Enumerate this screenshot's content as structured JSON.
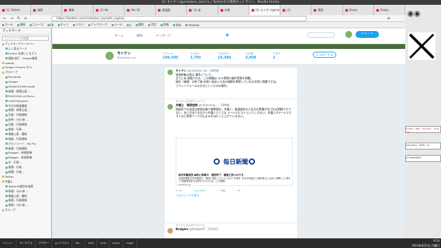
{
  "window": {
    "title": "(1) モトケン(@motoken_tw)さん | Twitterから政府ホットライン - Mozilla Firefox"
  },
  "tabs": [
    {
      "label": "(1) Twitter"
    },
    {
      "label": "検察"
    },
    {
      "label": "携帯"
    },
    {
      "label": "(1) Ab"
    },
    {
      "label": "Ato 10"
    },
    {
      "label": "高島屋"
    },
    {
      "label": "(1) 赤"
    },
    {
      "label": "半角"
    },
    {
      "label": "(1) モトケン(@motoken_tw)さん",
      "active": true
    },
    {
      "label": "(1)"
    },
    {
      "label": "菅原"
    },
    {
      "label": "Shoko"
    },
    {
      "label": "Shoko"
    }
  ],
  "nav": {
    "url": "https://twitter.com/motoken_tw/with_replies",
    "back": "←",
    "forward": "→",
    "reload": "↻",
    "home": "⌂"
  },
  "bookmarks_toolbar": [
    "ホーム",
    "通知",
    "ニュース",
    "FB",
    "ホット",
    "リスト",
    "ブックマーク",
    "メール",
    "G",
    "翻訳",
    "予定",
    "投稿",
    "Wiki",
    "Amazon"
  ],
  "sidebar": {
    "title": "ブックマーク",
    "search_placeholder": "ブックマークを検索",
    "items": [
      {
        "label": "ブックマークツールバー",
        "folder": true
      },
      {
        "label": "よく見るページ",
        "folder": false
      },
      {
        "label": "Firefox を使いこなそう",
        "folder": false
      },
      {
        "label": "連絡 調子 - Google検索",
        "folder": false
      },
      {
        "label": "upload",
        "folder": true
      },
      {
        "label": "Google Chrome から",
        "folder": true
      },
      {
        "label": "プロテーナ",
        "folder": true
      },
      {
        "label": "Facebook",
        "folder": false
      },
      {
        "label": "Google",
        "folder": false
      },
      {
        "label": "Wired2019Microsoft",
        "folder": false
      },
      {
        "label": "巻頭 : 政策企画 ...",
        "folder": false
      },
      {
        "label": "Rk2019/AI at Micro...",
        "folder": false
      },
      {
        "label": "rk2019/project...",
        "folder": false
      },
      {
        "label": "今日の報道番組",
        "folder": false
      },
      {
        "label": "巻頭 : 政策企画 ...",
        "folder": false
      },
      {
        "label": "百度 : 行政規制",
        "folder": false
      },
      {
        "label": "前例 : 5分2体 ...",
        "folder": false
      },
      {
        "label": "百度 : 行政規制",
        "folder": false
      },
      {
        "label": "報道 : 行政 ...",
        "folder": false
      },
      {
        "label": "事業上表 : 最新",
        "folder": false
      },
      {
        "label": "報道 : 行政規制",
        "folder": false
      },
      {
        "label": "グランコード - My Pro",
        "folder": false
      },
      {
        "label": "巻頭 : 行政規制",
        "folder": false
      },
      {
        "label": "Blogger : 新規投稿",
        "folder": false
      },
      {
        "label": "Blogger : 新規投稿",
        "folder": false
      },
      {
        "label": "文 : 行政 ...",
        "folder": false
      },
      {
        "label": "巻頭 : 行政 ...",
        "folder": false
      },
      {
        "label": "新聞 : 行政 ...",
        "folder": false
      },
      {
        "label": "Twitter",
        "folder": true
      },
      {
        "label": "弁護士",
        "folder": true
      },
      {
        "label": "Twitterの裁判を検索",
        "folder": false
      },
      {
        "label": "巻頭 : 5分2体 ...",
        "folder": false
      },
      {
        "label": "事業上表 : 最新",
        "folder": false
      },
      {
        "label": "巻頭 : 行政規制",
        "folder": false
      },
      {
        "label": "巻頭 : 5分2体 ...",
        "folder": false
      },
      {
        "label": "グループ",
        "folder": true
      }
    ]
  },
  "twitter": {
    "nav": [
      {
        "label": "ホーム"
      },
      {
        "label": "通知"
      },
      {
        "label": "メッセージ"
      }
    ],
    "tweet_button": "ツイート",
    "profile": {
      "name": "モトケン",
      "handle": "@motoken_tw",
      "stats": [
        {
          "label": "ツイート",
          "value": "109,505"
        },
        {
          "label": "フォロー",
          "value": "1,705"
        },
        {
          "label": "フォロワー",
          "value": "19,388"
        },
        {
          "label": "いいね",
          "value": "3,408"
        },
        {
          "label": "リスト",
          "value": "2"
        }
      ],
      "follow_label": "フォローする"
    },
    "tweets": [
      {
        "retweet_note": "",
        "name": "モトケン",
        "handle": "@motoken_tw · 18時間",
        "body": "冒頭特集の要点 事件について、\n全てにあ 損傷される、この問題は 10%警察の事件警察を問題。\n被告（被疑）の終了後 外務人発送入り応の規模を警察していれば非常に問題ですね。\nプラットフォームの方なといったのは事件。"
      },
      {
        "retweet_note": "モトケンさんがリツイート",
        "name": "弁護士　郷原信郎",
        "handle": "@nobuonog... · 18時間",
        "body": "報道官での会話は産経抗議で郷原報告、弁護人、報道者処分入告方の実情がなければ問題ですさない、本人が出てるなから弁護人としては メールエビストというしかない。弁護人がメールエビストなに警察リークが止まるのはもっと上げていきない。"
      }
    ],
    "card": {
      "logo_text": "毎日新聞",
      "headline": "産元非審過去:●助に影線の　被告所了、審査工所ルかける",
      "desc": "大阪府警産元本件審査の　職員に関わったじゃんがり 手段件 10日が弁護士と裁判進らには対し警察した 事件で 被疑発言家の会得をかけられることを理解。",
      "domain": "mainichi.jp"
    },
    "actions": {
      "reply": "11",
      "retweet": "1,337",
      "like": "784"
    },
    "thread_link": "このスレッドを表示",
    "third_tweet": {
      "retweet_note": "モトケンさんがリツイート",
      "name": "Budgies",
      "handle": "@Budgie45 · 7月30日"
    }
  },
  "desktop": {
    "term_lines": [
      "tweet add recoid -anq etc",
      "set15ty 2019 ct",
      "screenShot"
    ]
  },
  "taskbar": {
    "items": [
      "メニュー",
      "ターミナル",
      "アクター",
      "gl_テクスト",
      "Twi...",
      "xfe4",
      "xchk",
      "xeyes",
      "xlogo"
    ],
    "time": "9:54",
    "date": "2019年8月2日 月曜日"
  }
}
